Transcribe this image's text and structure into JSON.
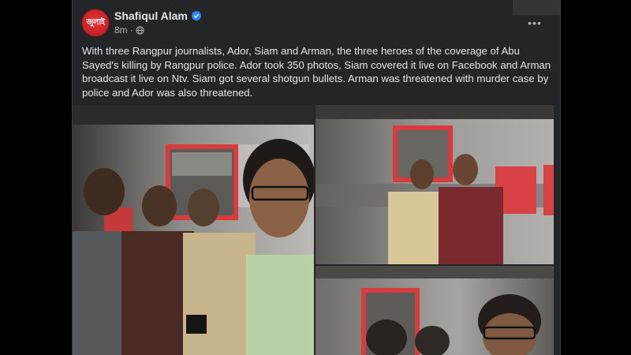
{
  "post": {
    "author": "Shafiqul Alam",
    "avatar_text": "জুলাই",
    "time": "8m",
    "privacy_icon": "globe-icon",
    "verified_icon": "verified-badge-icon",
    "more_icon": "more-options-icon",
    "more_label": "•••",
    "text": "With three Rangpur journalists, Ador, Siam and Arman, the three heroes of the coverage of Abu Sayed's killing by Rangpur police. Ador took 350 photos, Siam covered it live on Facebook and Arman broadcast it live on Ntv. Siam got several shotgun bullets. Arman was threatened with murder case by police and Ador was also threatened."
  },
  "colors": {
    "card": "#242526",
    "text": "#e4e6eb",
    "secondary": "#b0b3b8",
    "verified": "#2d88ff",
    "avatar": "#c41f24"
  }
}
